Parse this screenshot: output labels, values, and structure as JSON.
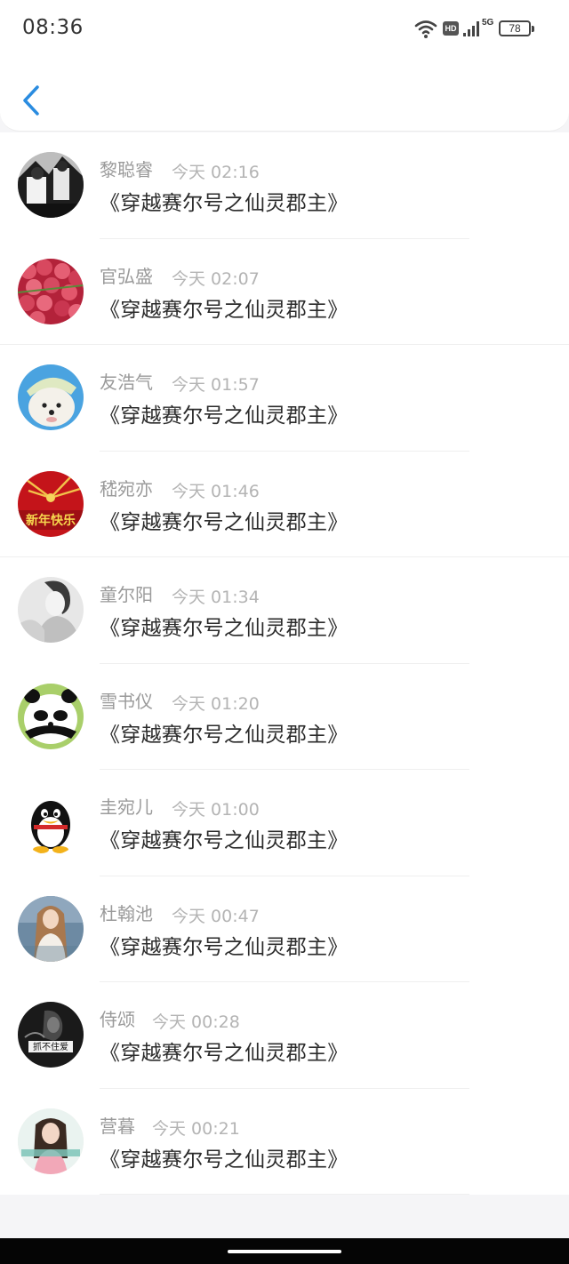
{
  "status_bar": {
    "time": "08:36",
    "network": "5G",
    "hd": "HD",
    "battery": "78"
  },
  "header": {
    "back_icon": "chevron-left-icon"
  },
  "messages": [
    {
      "name": "黎聪睿",
      "time": "今天 02:16",
      "text": "《穿越赛尔号之仙灵郡主》"
    },
    {
      "name": "官弘盛",
      "time": "今天 02:07",
      "text": "《穿越赛尔号之仙灵郡主》"
    },
    {
      "name": "友浩气",
      "time": "今天 01:57",
      "text": "《穿越赛尔号之仙灵郡主》"
    },
    {
      "name": "嵇宛亦",
      "time": "今天 01:46",
      "text": "《穿越赛尔号之仙灵郡主》"
    },
    {
      "name": "童尔阳",
      "time": "今天 01:34",
      "text": "《穿越赛尔号之仙灵郡主》"
    },
    {
      "name": "雪书仪",
      "time": "今天 01:20",
      "text": "《穿越赛尔号之仙灵郡主》"
    },
    {
      "name": "圭宛儿",
      "time": "今天 01:00",
      "text": "《穿越赛尔号之仙灵郡主》"
    },
    {
      "name": "杜翰池",
      "time": "今天 00:47",
      "text": "《穿越赛尔号之仙灵郡主》"
    },
    {
      "name": "侍颂",
      "time": "今天 00:28",
      "text": "《穿越赛尔号之仙灵郡主》"
    },
    {
      "name": "营暮",
      "time": "今天 00:21",
      "text": "《穿越赛尔号之仙灵郡主》"
    }
  ],
  "avatar_texts": {
    "avatar4": "新年快乐",
    "avatar9": "抓不住爱"
  },
  "colors": {
    "accent": "#2a8ce0",
    "name": "#9a9a9a",
    "time": "#b4b4b4",
    "message": "#2b2b2b"
  }
}
